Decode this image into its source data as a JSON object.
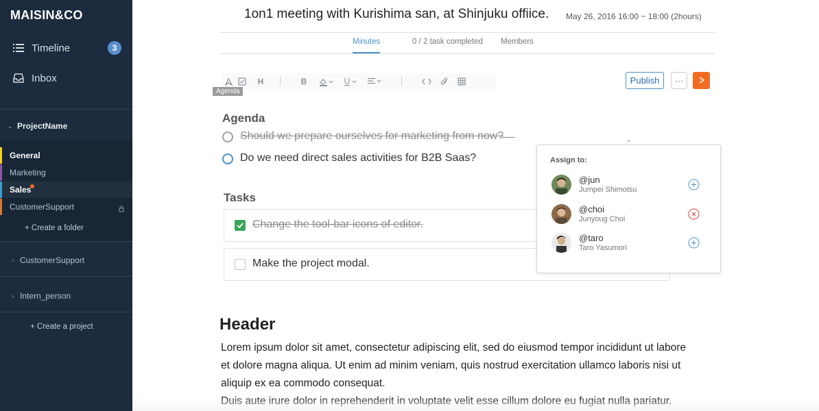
{
  "sidebar": {
    "brand": "MAISIN&CO",
    "nav": [
      {
        "label": "Timeline",
        "icon": "list-icon",
        "badge": "3"
      },
      {
        "label": "Inbox",
        "icon": "inbox-icon"
      }
    ],
    "project": {
      "name": "ProjectName",
      "icon": "chevron-down-icon"
    },
    "folders": [
      {
        "label": "General",
        "color": "#f5d016",
        "active": true
      },
      {
        "label": "Marketing",
        "color": "#8e55a8",
        "active": false
      },
      {
        "label": "Sales",
        "color": "#3aa0d8",
        "active": true,
        "unread": true
      },
      {
        "label": "CustomerSupport",
        "color": "#e2762c",
        "active": false,
        "locked": true
      }
    ],
    "create_folder": "+ Create a folder",
    "other_projects": [
      {
        "label": "CustomerSupport"
      },
      {
        "label": "Intern_person"
      }
    ],
    "create_project": "+ Create a project"
  },
  "meeting": {
    "title": "1on1 meeting with Kurishima san, at Shinjuku offiice.",
    "date": "May 26, 2016",
    "time": "16:00 ~ 18:00 (2hours)"
  },
  "tabs": [
    {
      "label": "Minutes",
      "active": true
    },
    {
      "label": "0 / 2 task completed",
      "active": false
    },
    {
      "label": "Members",
      "active": false
    }
  ],
  "toolbar": {
    "tooltip": "Agenda",
    "publish_label": "Publish",
    "more_label": "···",
    "accent": "#f26b22"
  },
  "agenda": {
    "title": "Agenda",
    "items": [
      {
        "text": "Should we prepare ourselves for marketing from now?",
        "done": true
      },
      {
        "text": "Do we need direct sales activities for B2B Saas?",
        "done": false
      }
    ]
  },
  "tasks": {
    "title": "Tasks",
    "items": [
      {
        "text": "Change the tool-bar icons of editor.",
        "done": true
      },
      {
        "text": "Make the project modal.",
        "done": false
      }
    ]
  },
  "body": {
    "header": "Header",
    "lines": [
      "Lorem ipsum dolor sit amet, consectetur adipiscing elit, sed do eiusmod tempor incididunt ut labore",
      "et dolore magna aliqua. Ut enim ad minim veniam, quis nostrud exercitation ullamco laboris nisi ut",
      "aliquip ex ea commodo consequat.",
      "Duis aute irure dolor in reprehenderit in voluptate velit esse cillum dolore eu fugiat nulla pariatur."
    ]
  },
  "assign": {
    "title": "Assign to:",
    "members": [
      {
        "handle": "@jun",
        "name": "Jumpei Shimotsu",
        "action": "add-icon",
        "action_color": "#4a90c8"
      },
      {
        "handle": "@choi",
        "name": "Junyoug Choi",
        "action": "remove-icon",
        "action_color": "#d9403a"
      },
      {
        "handle": "@taro",
        "name": "Taro Yasumori",
        "action": "add-icon",
        "action_color": "#4a90c8"
      }
    ]
  }
}
